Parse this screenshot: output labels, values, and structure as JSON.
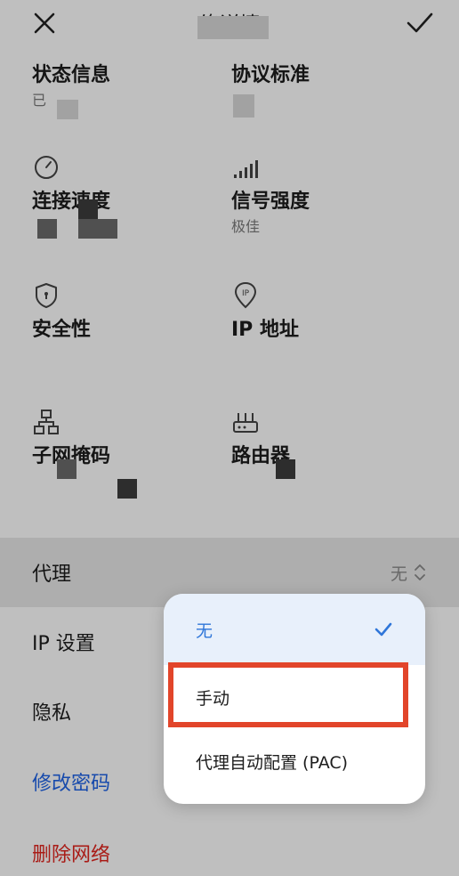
{
  "header": {
    "title": "络详情",
    "close_icon": "close-icon",
    "confirm_icon": "check-icon"
  },
  "info": {
    "status": {
      "label": "状态信息",
      "value": "已"
    },
    "standard": {
      "label": "协议标准",
      "value": ""
    },
    "speed": {
      "label": "连接速度",
      "value": "",
      "icon": "speedometer-icon"
    },
    "signal": {
      "label": "信号强度",
      "value": "极佳",
      "icon": "signal-bars-icon"
    },
    "security": {
      "label": "安全性",
      "value": "",
      "icon": "shield-icon"
    },
    "ip": {
      "label": "IP 地址",
      "value": "",
      "icon": "ip-pin-icon"
    },
    "subnet": {
      "label": "子网掩码",
      "value": "",
      "icon": "network-topology-icon"
    },
    "router": {
      "label": "路由器",
      "value": "",
      "icon": "router-icon"
    }
  },
  "settings": {
    "proxy": {
      "label": "代理",
      "value": "无"
    },
    "ip_settings": {
      "label": "IP 设置"
    },
    "privacy": {
      "label": "隐私"
    },
    "change_password": "修改密码",
    "delete_network": "删除网络"
  },
  "popup": {
    "options": [
      {
        "label": "无",
        "selected": true
      },
      {
        "label": "手动",
        "selected": false
      },
      {
        "label": "代理自动配置 (PAC)",
        "selected": false
      }
    ]
  },
  "colors": {
    "accent_blue": "#2f76d9",
    "link_blue": "#1f63e6",
    "danger_red": "#e2261f",
    "focus_box": "#e2452a"
  }
}
